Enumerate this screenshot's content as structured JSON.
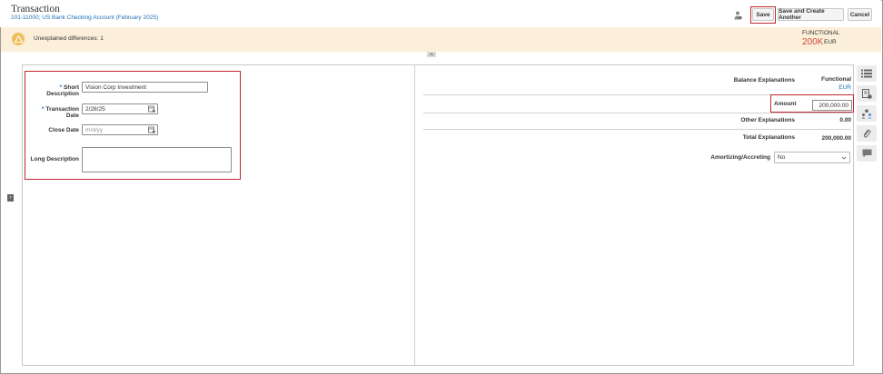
{
  "header": {
    "title": "Transaction",
    "subtitle": "101-11000; US Bank Checking Account (February 2025)",
    "save_label": "Save",
    "save_another_label": "Save and Create Another",
    "cancel_label": "Cancel"
  },
  "banner": {
    "message": "Unexplained differences: 1",
    "functional_label": "FUNCTIONAL",
    "functional_value": "200K",
    "functional_currency": "EUR"
  },
  "form": {
    "short_description_label": "Short Description",
    "short_description_value": "Vision Corp Investment",
    "transaction_date_label": "Transaction Date",
    "transaction_date_value": "2/28/25",
    "close_date_label": "Close Date",
    "close_date_placeholder": "m/d/yy",
    "long_description_label": "Long Description",
    "long_description_value": ""
  },
  "explanations": {
    "balance_label": "Balance Explanations",
    "functional_col": "Functional",
    "functional_currency": "EUR",
    "amount_label": "Amount",
    "amount_value": "200,000.00",
    "other_label": "Other Explanations",
    "other_value": "0.00",
    "total_label": "Total Explanations",
    "total_value": "200,000.00",
    "amortizing_label": "Amortizing/Accreting",
    "amortizing_value": "No"
  },
  "colors": {
    "accent_link": "#1f6fb5",
    "highlight": "#c0272d",
    "banner_bg": "#fcefd9",
    "functional_value": "#d0473a"
  }
}
